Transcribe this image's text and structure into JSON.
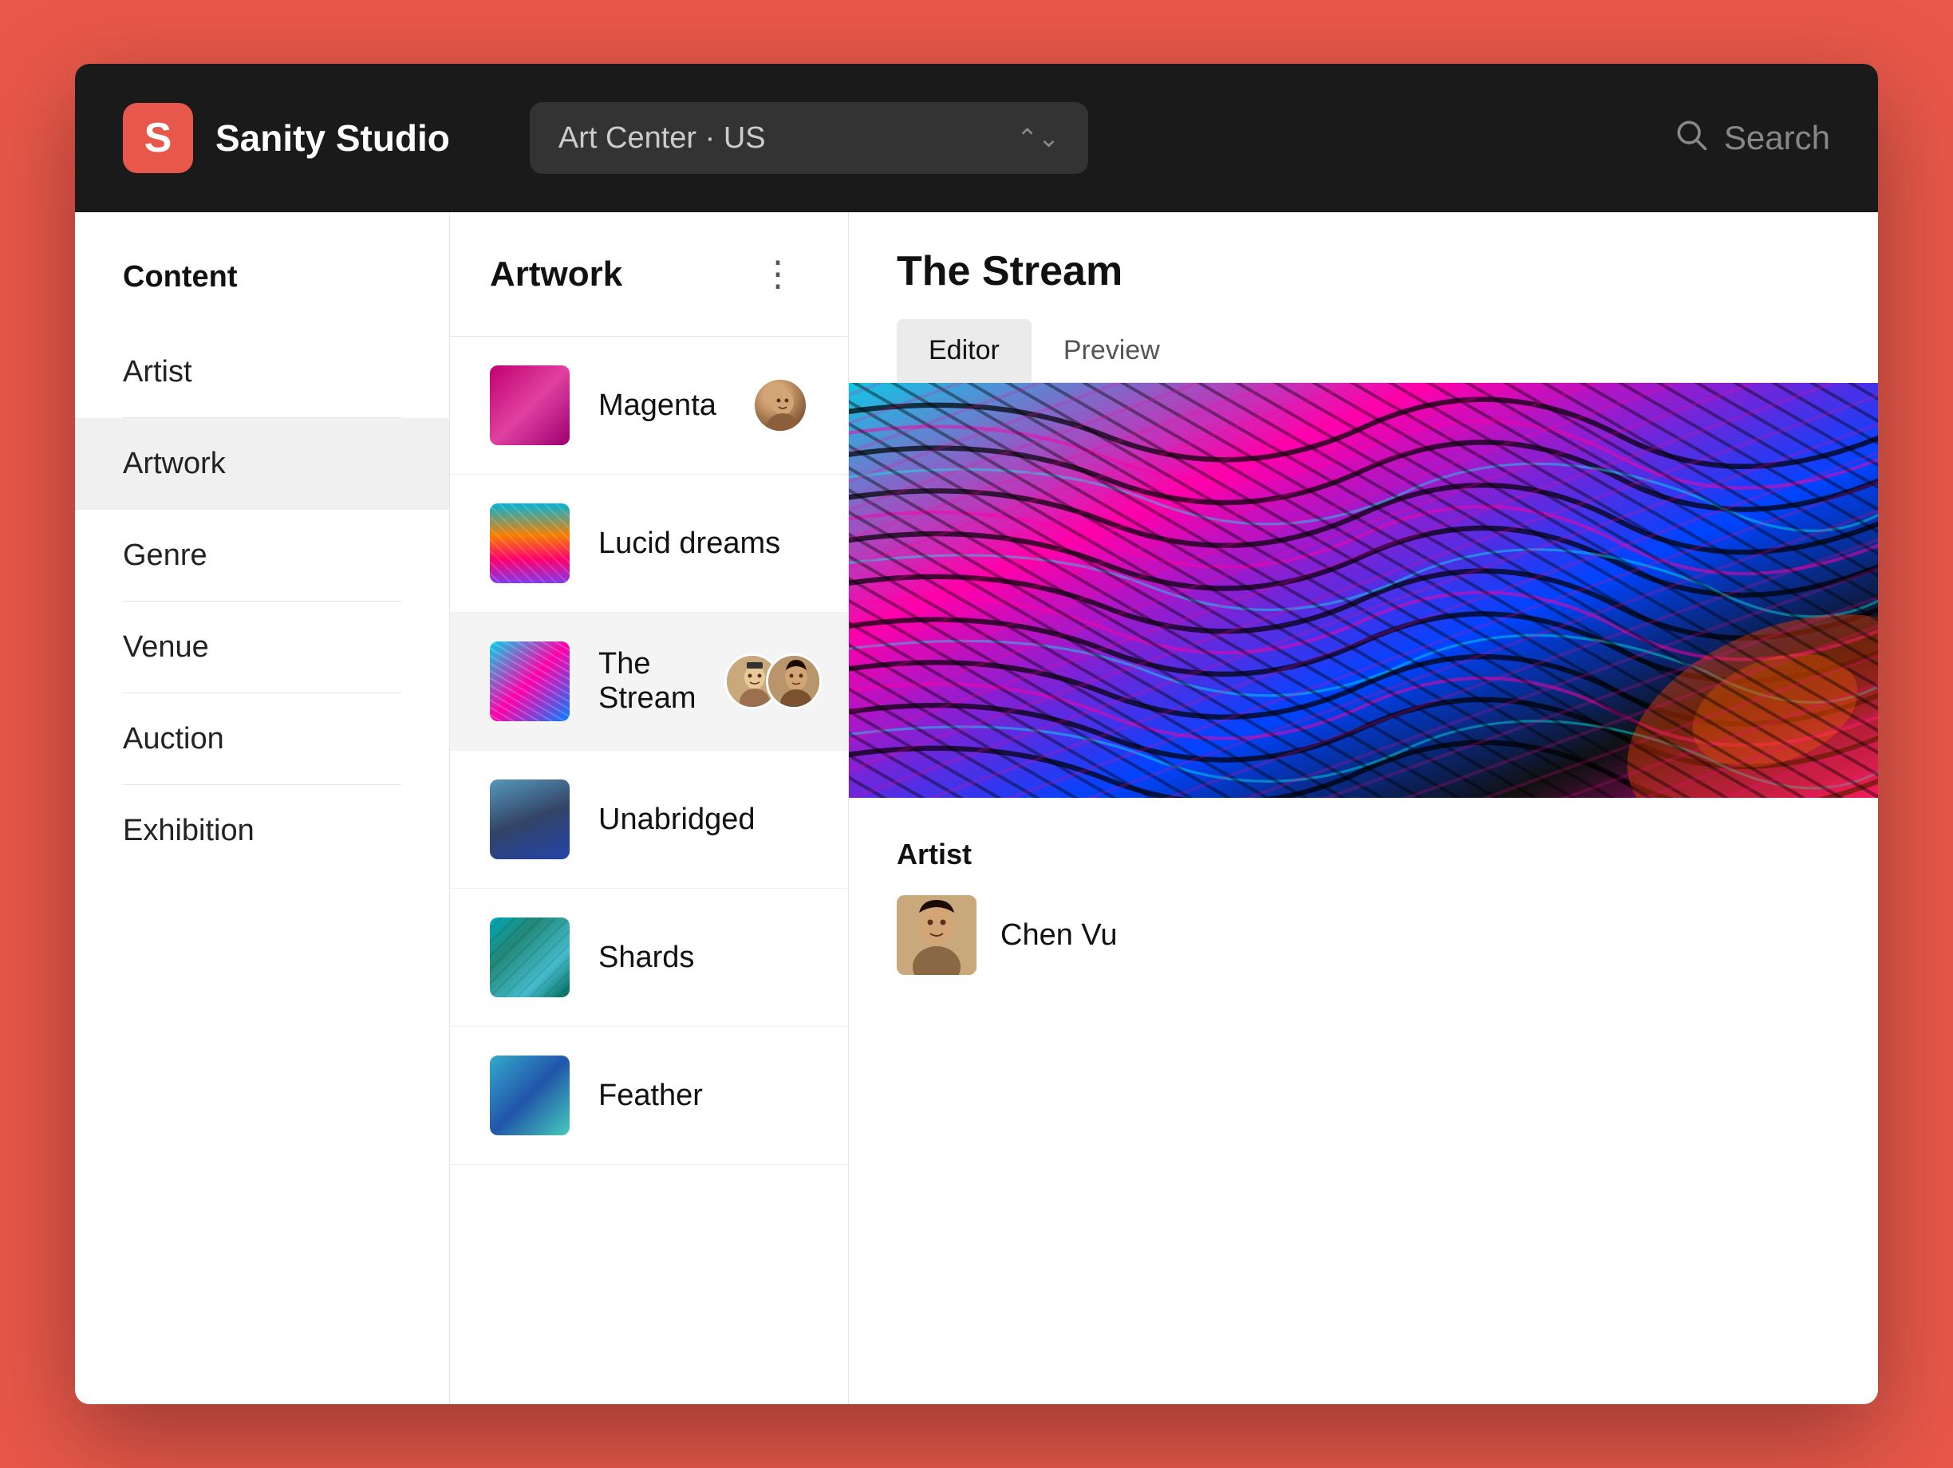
{
  "app": {
    "logo_letter": "S",
    "title": "Sanity Studio"
  },
  "topbar": {
    "workspace": "Art Center · US",
    "search_label": "Search"
  },
  "sidebar": {
    "header": "Content",
    "items": [
      {
        "id": "artist",
        "label": "Artist",
        "active": false
      },
      {
        "id": "artwork",
        "label": "Artwork",
        "active": true
      },
      {
        "id": "genre",
        "label": "Genre",
        "active": false
      },
      {
        "id": "venue",
        "label": "Venue",
        "active": false
      },
      {
        "id": "auction",
        "label": "Auction",
        "active": false
      },
      {
        "id": "exhibition",
        "label": "Exhibition",
        "active": false
      }
    ]
  },
  "middle_panel": {
    "title": "Artwork",
    "items": [
      {
        "id": "magenta",
        "name": "Magenta",
        "thumb_class": "thumb-magenta",
        "has_avatar": true,
        "selected": false
      },
      {
        "id": "lucid-dreams",
        "name": "Lucid dreams",
        "thumb_class": "thumb-lucid",
        "has_avatar": false,
        "selected": false
      },
      {
        "id": "the-stream",
        "name": "The Stream",
        "thumb_class": "thumb-stream",
        "has_avatar": true,
        "selected": true
      },
      {
        "id": "unabridged",
        "name": "Unabridged",
        "thumb_class": "thumb-unabridged",
        "has_avatar": false,
        "selected": false
      },
      {
        "id": "shards",
        "name": "Shards",
        "thumb_class": "thumb-shards",
        "has_avatar": false,
        "selected": false
      },
      {
        "id": "feather",
        "name": "Feather",
        "thumb_class": "thumb-feather",
        "has_avatar": false,
        "selected": false
      }
    ]
  },
  "right_panel": {
    "title": "The Stream",
    "tabs": [
      {
        "id": "editor",
        "label": "Editor",
        "active": true
      },
      {
        "id": "preview",
        "label": "Preview",
        "active": false
      }
    ],
    "artist_label": "Artist",
    "artist_name": "Chen Vu"
  }
}
